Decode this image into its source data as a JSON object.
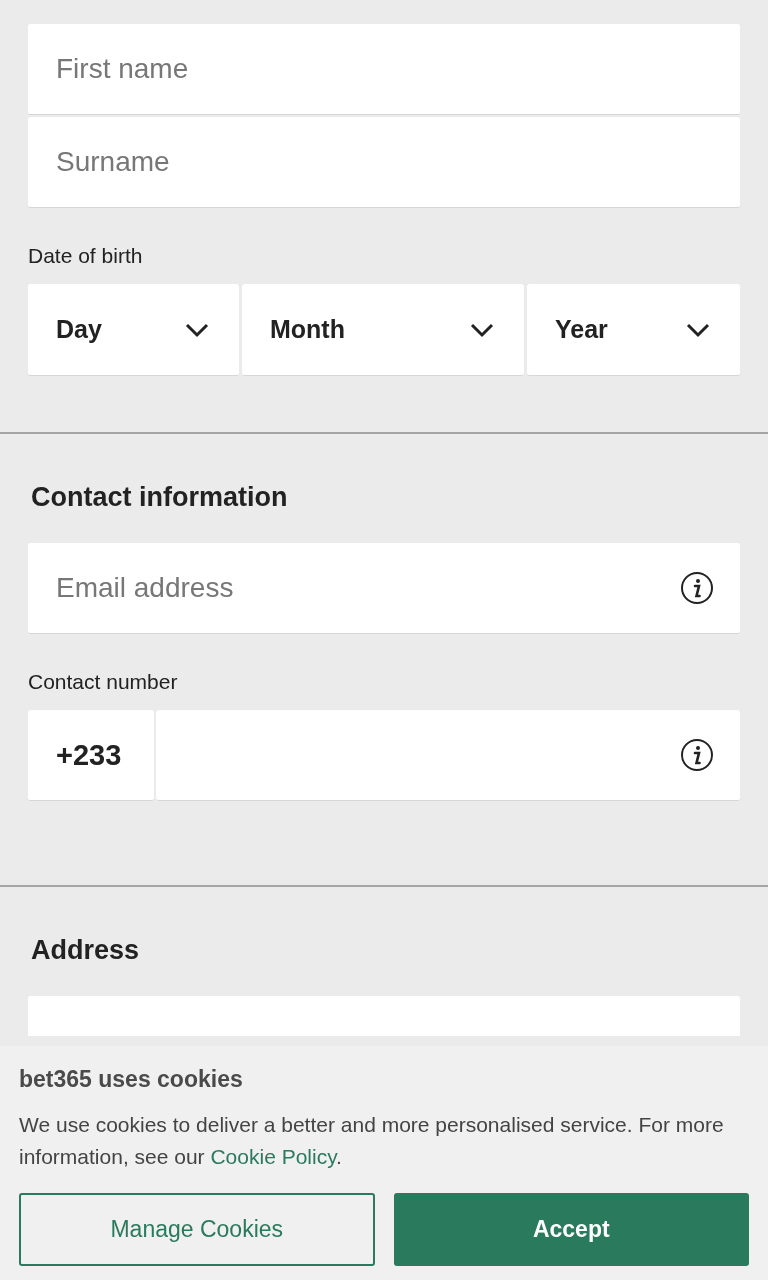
{
  "name_fields": [
    {
      "placeholder": "First name"
    },
    {
      "placeholder": "Surname"
    }
  ],
  "date_of_birth": {
    "label": "Date of birth",
    "selects": [
      {
        "value": "Day"
      },
      {
        "value": "Month"
      },
      {
        "value": "Year"
      }
    ]
  },
  "contact": {
    "heading": "Contact information",
    "email": {
      "placeholder": "Email address"
    },
    "number_label": "Contact number",
    "prefix": "+233"
  },
  "address": {
    "heading": "Address"
  },
  "cookie_banner": {
    "title": "bet365 uses cookies",
    "text": "We use cookies to deliver a better and more personalised service. For more information, see our",
    "link": "Cookie Policy",
    "link_end": ".",
    "buttons": [
      {
        "label": "Manage Cookies",
        "kind": "secondary"
      },
      {
        "label": "Accept",
        "kind": "primary"
      }
    ]
  }
}
